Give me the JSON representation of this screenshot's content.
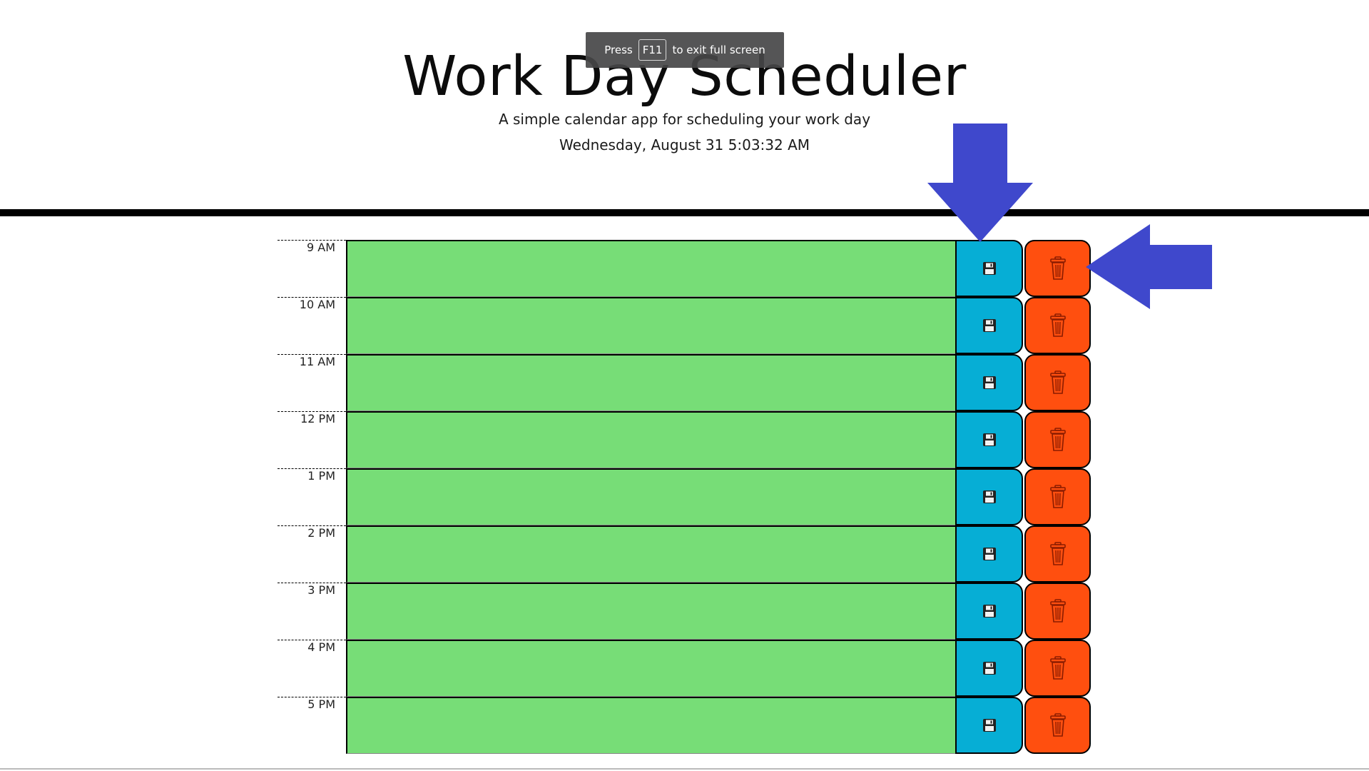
{
  "app": {
    "title": "Work Day Scheduler",
    "subtitle": "A simple calendar app for scheduling your work day",
    "current_datetime": "Wednesday, August 31 5:03:32 AM"
  },
  "fullscreen_toast": {
    "prefix": "Press",
    "key": "F11",
    "suffix": "to exit full screen"
  },
  "colors": {
    "future": "#77dd77",
    "save": "#06aed5",
    "delete": "#ff4f0f",
    "arrow": "#3f48cc"
  },
  "schedule": {
    "rows": [
      {
        "hour": "9 AM",
        "task": ""
      },
      {
        "hour": "10 AM",
        "task": ""
      },
      {
        "hour": "11 AM",
        "task": ""
      },
      {
        "hour": "12 PM",
        "task": ""
      },
      {
        "hour": "1 PM",
        "task": ""
      },
      {
        "hour": "2 PM",
        "task": ""
      },
      {
        "hour": "3 PM",
        "task": ""
      },
      {
        "hour": "4 PM",
        "task": ""
      },
      {
        "hour": "5 PM",
        "task": ""
      }
    ],
    "save_icon": "floppy-disk-icon",
    "delete_icon": "trash-can-icon"
  }
}
